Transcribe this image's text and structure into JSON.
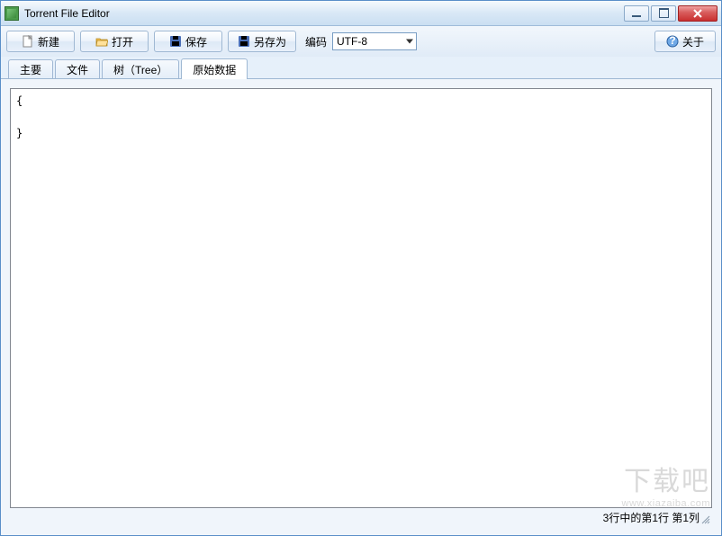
{
  "window": {
    "title": "Torrent File Editor"
  },
  "toolbar": {
    "new_label": "新建",
    "open_label": "打开",
    "save_label": "保存",
    "save_as_label": "另存为",
    "encoding_label": "编码",
    "encoding_value": "UTF-8",
    "about_label": "关于"
  },
  "tabs": {
    "items": [
      {
        "label": "主要"
      },
      {
        "label": "文件"
      },
      {
        "label": "树（Tree）"
      },
      {
        "label": "原始数据"
      }
    ],
    "active_index": 3
  },
  "editor": {
    "content": "{\n\n}"
  },
  "statusbar": {
    "text": "3行中的第1行  第1列"
  },
  "watermark": {
    "big": "下载吧",
    "small": "www.xiazaiba.com"
  }
}
